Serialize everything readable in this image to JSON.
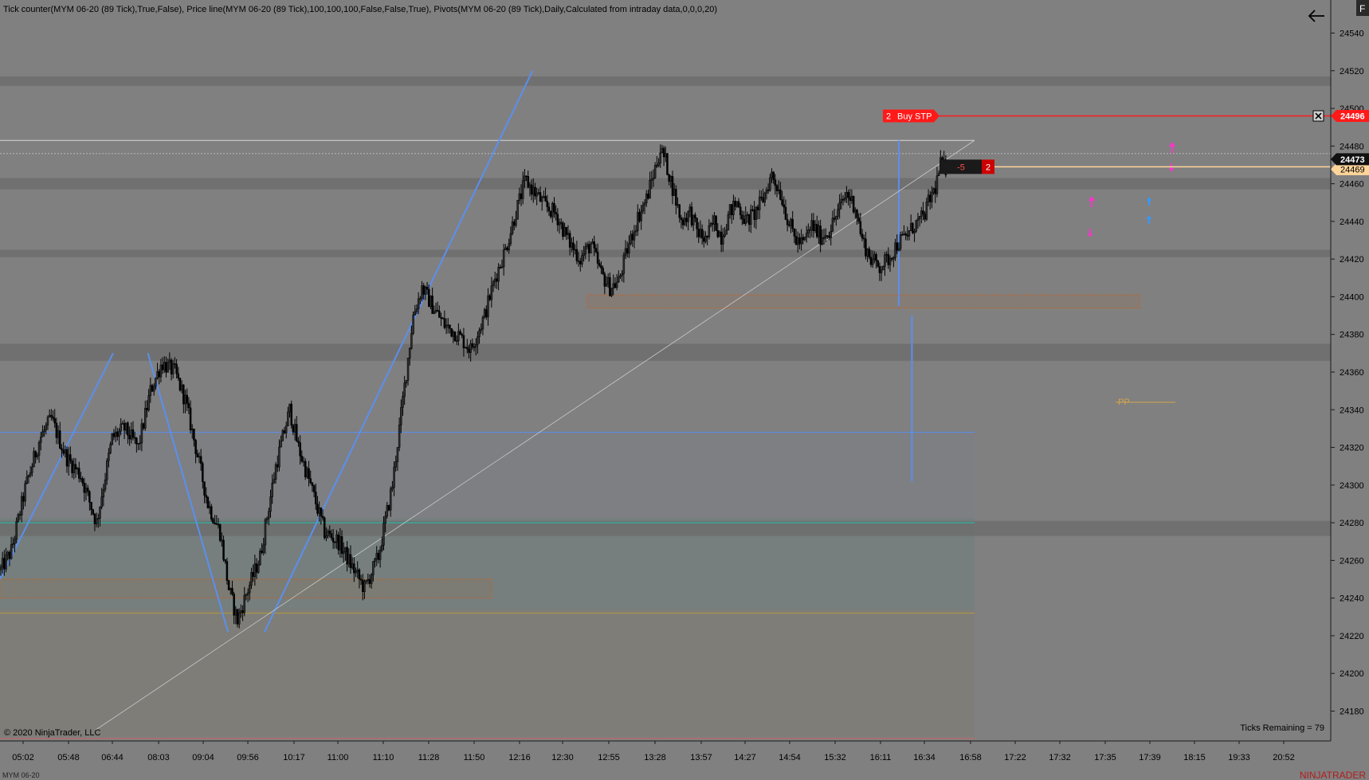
{
  "indicator_header": "Tick counter(MYM 06-20 (89 Tick),True,False), Price line(MYM 06-20 (89 Tick),100,100,100,False,False,True), Pivots(MYM 06-20 (89 Tick),Daily,Calculated from intraday data,0,0,0,20)",
  "copyright": "© 2020 NinjaTrader, LLC",
  "ticks_remaining": "Ticks Remaining = 79",
  "instrument_tab": "MYM 06-20",
  "brand_logo": "NINJATRADER",
  "float_button": "F",
  "pivot_label": "PP",
  "order": {
    "quantity": "2",
    "type": "Buy STP",
    "price": "24496"
  },
  "position": {
    "pnl": "-5",
    "quantity": "2",
    "avg_price": "24469"
  },
  "last_price": "24473",
  "colors": {
    "background": "#808080",
    "candle": "#000000",
    "order_line": "#ff1a1a",
    "position_line": "#ffd59a",
    "trend_line": "#5b8ff0",
    "zone_border": "#c9601f",
    "pivot": "#d4a54a",
    "volume_band": "#6e6e6e"
  },
  "chart_data": {
    "type": "candlestick",
    "price_axis": {
      "ticks": [
        24540,
        24520,
        24500,
        24480,
        24460,
        24440,
        24420,
        24400,
        24380,
        24360,
        24340,
        24320,
        24300,
        24280,
        24260,
        24240,
        24220,
        24200,
        24180
      ],
      "range": [
        24170,
        24547
      ]
    },
    "time_axis": [
      "05:02",
      "05:48",
      "06:44",
      "08:03",
      "09:04",
      "09:56",
      "10:17",
      "11:00",
      "11:10",
      "11:28",
      "11:50",
      "12:16",
      "12:30",
      "12:55",
      "13:28",
      "13:57",
      "14:27",
      "14:54",
      "15:32",
      "16:11",
      "16:34",
      "16:58",
      "17:22",
      "17:32",
      "17:35",
      "17:39",
      "18:15",
      "19:33",
      "20:52"
    ],
    "bar_period": "89 Tick",
    "price_path": [
      [
        0,
        24255
      ],
      [
        12,
        24265
      ],
      [
        28,
        24298
      ],
      [
        45,
        24325
      ],
      [
        58,
        24335
      ],
      [
        75,
        24315
      ],
      [
        92,
        24305
      ],
      [
        110,
        24280
      ],
      [
        128,
        24325
      ],
      [
        142,
        24330
      ],
      [
        158,
        24320
      ],
      [
        172,
        24350
      ],
      [
        185,
        24365
      ],
      [
        200,
        24360
      ],
      [
        212,
        24345
      ],
      [
        224,
        24320
      ],
      [
        238,
        24290
      ],
      [
        252,
        24275
      ],
      [
        262,
        24245
      ],
      [
        272,
        24228
      ],
      [
        282,
        24242
      ],
      [
        298,
        24262
      ],
      [
        316,
        24310
      ],
      [
        332,
        24340
      ],
      [
        342,
        24320
      ],
      [
        356,
        24300
      ],
      [
        372,
        24275
      ],
      [
        388,
        24270
      ],
      [
        402,
        24258
      ],
      [
        418,
        24245
      ],
      [
        434,
        24262
      ],
      [
        450,
        24300
      ],
      [
        462,
        24345
      ],
      [
        474,
        24390
      ],
      [
        484,
        24405
      ],
      [
        496,
        24395
      ],
      [
        510,
        24385
      ],
      [
        525,
        24380
      ],
      [
        540,
        24372
      ],
      [
        556,
        24390
      ],
      [
        568,
        24410
      ],
      [
        580,
        24425
      ],
      [
        592,
        24445
      ],
      [
        603,
        24462
      ],
      [
        614,
        24455
      ],
      [
        626,
        24448
      ],
      [
        638,
        24444
      ],
      [
        652,
        24430
      ],
      [
        666,
        24420
      ],
      [
        678,
        24428
      ],
      [
        690,
        24412
      ],
      [
        700,
        24405
      ],
      [
        710,
        24408
      ],
      [
        720,
        24425
      ],
      [
        732,
        24442
      ],
      [
        742,
        24452
      ],
      [
        750,
        24465
      ],
      [
        758,
        24478
      ],
      [
        764,
        24472
      ],
      [
        772,
        24458
      ],
      [
        782,
        24440
      ],
      [
        792,
        24445
      ],
      [
        800,
        24435
      ],
      [
        810,
        24430
      ],
      [
        820,
        24440
      ],
      [
        828,
        24432
      ],
      [
        838,
        24445
      ],
      [
        846,
        24450
      ],
      [
        856,
        24440
      ],
      [
        866,
        24444
      ],
      [
        876,
        24452
      ],
      [
        886,
        24465
      ],
      [
        896,
        24455
      ],
      [
        905,
        24440
      ],
      [
        914,
        24430
      ],
      [
        922,
        24428
      ],
      [
        932,
        24438
      ],
      [
        942,
        24432
      ],
      [
        952,
        24435
      ],
      [
        962,
        24445
      ],
      [
        972,
        24455
      ],
      [
        982,
        24448
      ],
      [
        990,
        24430
      ],
      [
        1000,
        24420
      ],
      [
        1010,
        24416
      ],
      [
        1020,
        24420
      ],
      [
        1030,
        24428
      ],
      [
        1040,
        24432
      ],
      [
        1050,
        24438
      ],
      [
        1060,
        24442
      ],
      [
        1068,
        24452
      ],
      [
        1074,
        24458
      ],
      [
        1080,
        24470
      ],
      [
        1086,
        24468
      ]
    ],
    "levels": [
      {
        "name": "order-buy-stp",
        "price": 24496
      },
      {
        "name": "position-avg",
        "price": 24469
      },
      {
        "name": "last-price",
        "price": 24473
      },
      {
        "name": "session-high",
        "price": 24483
      },
      {
        "name": "dotted-level",
        "price": 24476
      },
      {
        "name": "blue-level",
        "price": 24328
      },
      {
        "name": "cyan-level",
        "price": 24280
      },
      {
        "name": "olive-level",
        "price": 24232
      },
      {
        "name": "pivot-pp",
        "price": 24344
      }
    ],
    "volume_bands": [
      {
        "low": 24512,
        "high": 24517
      },
      {
        "low": 24457,
        "high": 24463
      },
      {
        "low": 24421,
        "high": 24425
      },
      {
        "low": 24366,
        "high": 24375
      },
      {
        "low": 24273,
        "high": 24281
      }
    ],
    "zones": [
      {
        "t0": 0,
        "t1": 565,
        "low": 24240,
        "high": 24250
      },
      {
        "t0": 675,
        "t1": 1310,
        "low": 24394,
        "high": 24401
      }
    ],
    "trend_lines": [
      {
        "p1": [
          0,
          24250
        ],
        "p2": [
          130,
          24370
        ]
      },
      {
        "p1": [
          170,
          24370
        ],
        "p2": [
          262,
          24222
        ]
      },
      {
        "p1": [
          304,
          24222
        ],
        "p2": [
          612,
          24520
        ]
      },
      {
        "p1": [
          1033,
          24483
        ],
        "p2": [
          1033,
          24395
        ]
      },
      {
        "p1": [
          1048,
          24390
        ],
        "p2": [
          1048,
          24302
        ]
      }
    ],
    "thin_trend": {
      "p1": [
        110,
        24170
      ],
      "p2": [
        1120,
        24483
      ]
    }
  }
}
